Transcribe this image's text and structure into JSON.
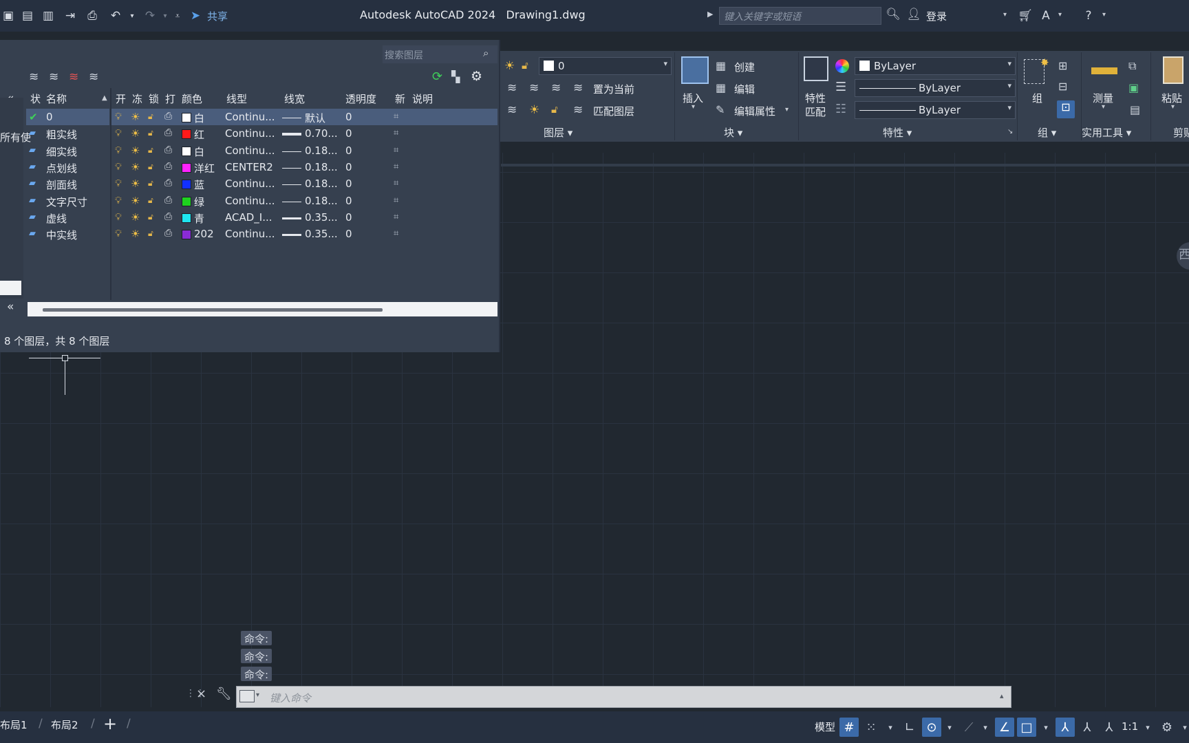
{
  "app": {
    "title": "Autodesk AutoCAD 2024",
    "filename": "Drawing1.dwg",
    "share_label": "共享",
    "search_placeholder": "键入关键字或短语",
    "login_label": "登录"
  },
  "ribbon": {
    "layer_panel": {
      "current_layer": "0",
      "set_current_label": "置为当前",
      "match_layer_label": "匹配图层",
      "title": "图层"
    },
    "block_panel": {
      "insert_label": "插入",
      "create_label": "创建",
      "edit_label": "编辑",
      "edit_attr_label": "编辑属性",
      "title": "块"
    },
    "properties_panel": {
      "match_label_1": "特性",
      "match_label_2": "匹配",
      "color_value": "ByLayer",
      "linetype_value": "ByLayer",
      "lineweight_value": "ByLayer",
      "title": "特性"
    },
    "groups_panel": {
      "group_label": "组",
      "title": "组"
    },
    "utilities_panel": {
      "measure_label": "测量",
      "title": "实用工具"
    },
    "clipboard_panel": {
      "paste_label": "粘贴",
      "title": "剪贴"
    }
  },
  "layer_palette": {
    "search_placeholder": "搜索图层",
    "tree_partial_label": "所有使",
    "status_text": "8 个图层，共 8 个图层",
    "columns": [
      "状",
      "名称",
      "开",
      "冻",
      "锁",
      "打",
      "颜色",
      "线型",
      "线宽",
      "透明度",
      "新",
      "说明"
    ],
    "layers": [
      {
        "name": "0",
        "color_name": "白",
        "color": "#ffffff",
        "linetype": "Continu...",
        "lineweight": "默认",
        "transparency": "0",
        "current": true,
        "lw_thick": 1
      },
      {
        "name": "粗实线",
        "color_name": "红",
        "color": "#ff1a1a",
        "linetype": "Continu...",
        "lineweight": "0.70...",
        "transparency": "0",
        "current": false,
        "lw_thick": 4
      },
      {
        "name": "细实线",
        "color_name": "白",
        "color": "#ffffff",
        "linetype": "Continu...",
        "lineweight": "0.18...",
        "transparency": "0",
        "current": false,
        "lw_thick": 1
      },
      {
        "name": "点划线",
        "color_name": "洋红",
        "color": "#ff22ff",
        "linetype": "CENTER2",
        "lineweight": "0.18...",
        "transparency": "0",
        "current": false,
        "lw_thick": 1
      },
      {
        "name": "剖面线",
        "color_name": "蓝",
        "color": "#1230ff",
        "linetype": "Continu...",
        "lineweight": "0.18...",
        "transparency": "0",
        "current": false,
        "lw_thick": 1
      },
      {
        "name": "文字尺寸",
        "color_name": "绿",
        "color": "#1ed21e",
        "linetype": "Continu...",
        "lineweight": "0.18...",
        "transparency": "0",
        "current": false,
        "lw_thick": 1
      },
      {
        "name": "虚线",
        "color_name": "青",
        "color": "#1ee6f0",
        "linetype": "ACAD_I...",
        "lineweight": "0.35...",
        "transparency": "0",
        "current": false,
        "lw_thick": 3
      },
      {
        "name": "中实线",
        "color_name": "202",
        "color": "#8a2bd6",
        "linetype": "Continu...",
        "lineweight": "0.35...",
        "transparency": "0",
        "current": false,
        "lw_thick": 3
      }
    ]
  },
  "command": {
    "history": [
      "命令:",
      "命令:",
      "命令:"
    ],
    "input_placeholder": "键入命令"
  },
  "status": {
    "tabs": [
      "布局1",
      "布局2"
    ],
    "model_label": "模型",
    "scale_label": "1:1"
  },
  "viewcube_partial": "西"
}
